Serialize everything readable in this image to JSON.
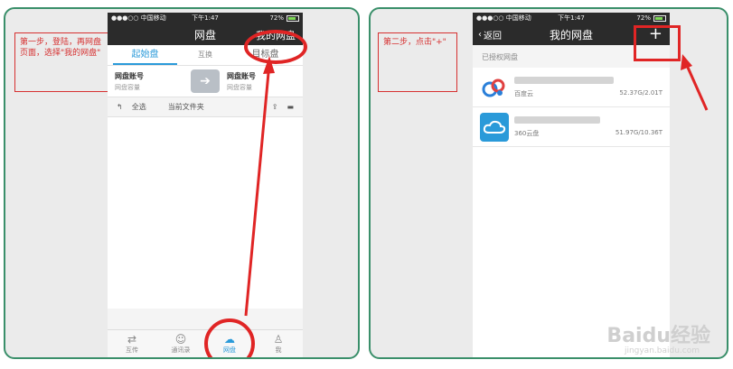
{
  "left": {
    "status": {
      "carrier": "●●●○○ 中国移动",
      "time": "下午1:47",
      "battery": "72%"
    },
    "nav": {
      "title": "网盘",
      "right_button": "我的网盘"
    },
    "tabs": {
      "start": "起始盘",
      "swap": "互换",
      "target": "目标盘"
    },
    "accounts": [
      {
        "name": "网盘账号",
        "capacity": "网盘容量"
      },
      {
        "name": "网盘账号",
        "capacity": "网盘容量"
      }
    ],
    "toolbar": {
      "select_all": "全选",
      "current_folder": "当前文件夹"
    },
    "bottom_tabs": [
      {
        "label": "互传",
        "icon": "transfer-icon"
      },
      {
        "label": "通讯录",
        "icon": "contacts-icon"
      },
      {
        "label": "网盘",
        "icon": "cloud-icon"
      },
      {
        "label": "我",
        "icon": "person-icon"
      }
    ],
    "note": "第一步，登陆，再网盘页面，选择\"我的网盘\""
  },
  "right": {
    "status": {
      "carrier": "●●●○○ 中国移动",
      "time": "下午1:47",
      "battery": "72%"
    },
    "nav": {
      "back": "返回",
      "title": "我的网盘",
      "plus": "+"
    },
    "section_title": "已授权网盘",
    "disks": [
      {
        "provider": "百度云",
        "usage": "52.37G/2.01T",
        "icon": "baidu-cloud-icon"
      },
      {
        "provider": "360云盘",
        "usage": "51.97G/10.36T",
        "icon": "360-cloud-icon"
      }
    ],
    "note": "第二步，点击\"+\""
  },
  "watermark": {
    "main": "Baidu经验",
    "sub": "jingyan.baidu.com"
  },
  "colors": {
    "accent": "#2a9ad9",
    "annotation_red": "#e02525",
    "border_green": "#3a8f6a",
    "navbar": "#2b2b2b"
  }
}
